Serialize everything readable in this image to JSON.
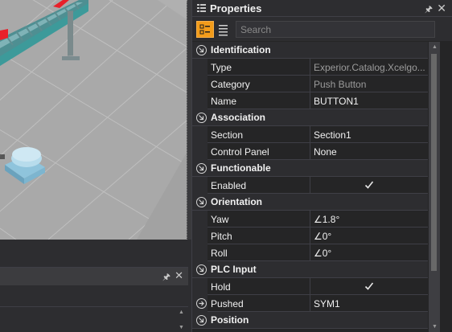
{
  "properties_panel": {
    "title": "Properties",
    "search_placeholder": "Search",
    "categories": [
      {
        "label": "Identification",
        "rows": [
          {
            "name": "Type",
            "value": "Experior.Catalog.Xcelgo...",
            "dim": true
          },
          {
            "name": "Category",
            "value": "Push Button",
            "dim": true
          },
          {
            "name": "Name",
            "value": "BUTTON1"
          }
        ]
      },
      {
        "label": "Association",
        "rows": [
          {
            "name": "Section",
            "value": "Section1"
          },
          {
            "name": "Control Panel",
            "value": "None"
          }
        ]
      },
      {
        "label": "Functionable",
        "rows": [
          {
            "name": "Enabled",
            "checkbox": true,
            "checked": true
          }
        ]
      },
      {
        "label": "Orientation",
        "rows": [
          {
            "name": "Yaw",
            "value": "∠1.8°"
          },
          {
            "name": "Pitch",
            "value": "∠0°"
          },
          {
            "name": "Roll",
            "value": "∠0°"
          }
        ]
      },
      {
        "label": "PLC Input",
        "rows": [
          {
            "name": "Hold",
            "checkbox": true,
            "checked": true
          },
          {
            "name": "Pushed",
            "value": "SYM1",
            "expandable": true
          }
        ]
      },
      {
        "label": "Position",
        "rows": []
      }
    ]
  },
  "colors": {
    "accent": "#f39c1a",
    "conveyor_frame": "#3d9a9a",
    "conveyor_marker": "#e8202a",
    "floor": "#a9a9a9",
    "button_body": "#a9d2e6"
  },
  "icons": {
    "categorized_view": "categorized-list-icon",
    "alphabetical_view": "alphabetical-list-icon",
    "category_expander": "collapse-circle-icon",
    "pin": "pin-icon",
    "close": "close-icon"
  }
}
